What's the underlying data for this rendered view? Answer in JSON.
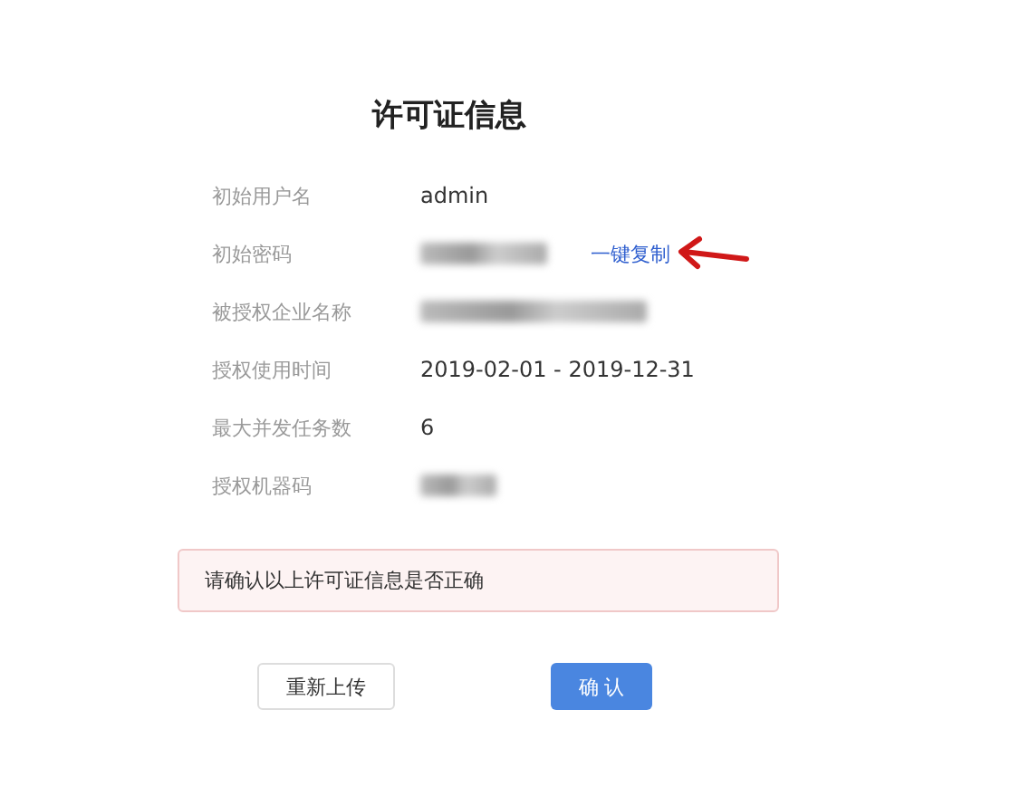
{
  "title": "许可证信息",
  "rows": [
    {
      "label": "初始用户名",
      "kind": "text",
      "value": "admin"
    },
    {
      "label": "初始密码",
      "kind": "redacted",
      "link": "一键复制"
    },
    {
      "label": "被授权企业名称",
      "kind": "redacted"
    },
    {
      "label": "授权使用时间",
      "kind": "text",
      "value": "2019-02-01 - 2019-12-31"
    },
    {
      "label": "最大并发任务数",
      "kind": "text",
      "value": "6"
    },
    {
      "label": "授权机器码",
      "kind": "redacted"
    }
  ],
  "alert": "请确认以上许可证信息是否正确",
  "buttons": [
    {
      "label": "重新上传",
      "kind": "secondary"
    },
    {
      "label": "确 认",
      "kind": "primary"
    }
  ]
}
